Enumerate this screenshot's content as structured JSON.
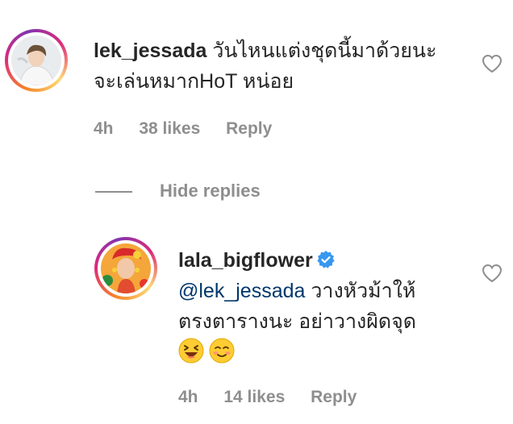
{
  "comment": {
    "username": "lek_jessada",
    "text_line1": "วันไหนแต่งชุดนี้มาด้วยนะ",
    "text_line2": "จะเล่นหมากHoT หน่อย",
    "time": "4h",
    "likes": "38 likes",
    "reply_label": "Reply"
  },
  "thread": {
    "hide_replies_label": "Hide replies"
  },
  "reply": {
    "username": "lala_bigflower",
    "verified": true,
    "mention": "@lek_jessada",
    "text_line1_rest": "วางหัวม้าให้",
    "text_line2": "ตรงตารางนะ อย่าวางผิดจุด",
    "emojis": [
      "laughing-face",
      "smiling-face"
    ],
    "time": "4h",
    "likes": "14 likes",
    "reply_label": "Reply"
  },
  "colors": {
    "text": "#262626",
    "muted": "#8e8e8e",
    "mention": "#00376b",
    "verified": "#3897f0"
  }
}
